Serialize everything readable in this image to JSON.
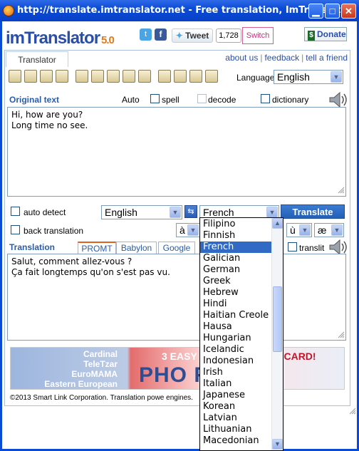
{
  "window": {
    "title": "http://translate.imtranslator.net - Free translation, ImTranslat...",
    "minimize_glyph": "▁",
    "maximize_glyph": "□",
    "close_glyph": "✕"
  },
  "header": {
    "logo_prefix": "imTranslator",
    "logo_version": "5.0",
    "tweet_label": "Tweet",
    "tweet_count": "1,728",
    "switch_label": "Switch",
    "donate_label": "Donate"
  },
  "nav": {
    "tab_translator": "Translator",
    "links": [
      "about us",
      "feedback",
      "tell a friend"
    ]
  },
  "toolbar": {
    "language_label": "Language",
    "language_value": "English",
    "icons": [
      "edit-icon",
      "print-icon",
      "virtual-keyboard-icon",
      "clear-icon",
      "dictionary-book-icon",
      "spell-check-icon",
      "keyboard-icon",
      "settings-icon",
      "voice-icon",
      "printer-icon",
      "image-icon",
      "history-icon",
      "help-icon"
    ]
  },
  "original": {
    "label": "Original text",
    "auto_label": "Auto",
    "spell_label": "spell",
    "decode_label": "decode",
    "dictionary_label": "dictionary",
    "text": "Hi, how are you?\nLong time no see."
  },
  "controls": {
    "auto_detect_label": "auto detect",
    "back_translation_label": "back translation",
    "source_lang": "English",
    "target_lang": "French",
    "translate_label": "Translate",
    "char_a": "à",
    "char_u": "ù",
    "char_ae": "æ",
    "swap_glyph": "⇆"
  },
  "translation": {
    "label": "Translation",
    "engines": [
      "PROMT",
      "Babylon",
      "Google"
    ],
    "translit_label": "translit",
    "text": "Salut, comment allez-vous ?\nÇa fait longtemps qu'on s'est pas vu."
  },
  "banner": {
    "links": [
      "Cardinal",
      "TeleTzar",
      "EuroMAMA",
      "Eastern European"
    ],
    "easy": "3 EASY",
    "card": "A CARD!",
    "big": "PHO        RDS"
  },
  "footer": {
    "text": "©2013 Smart Link Corporation. Translation powe                           engines."
  },
  "dropdown": {
    "items": [
      "Filipino",
      "Finnish",
      "French",
      "Galician",
      "German",
      "Greek",
      "Hebrew",
      "Hindi",
      "Haitian Creole",
      "Hausa",
      "Hungarian",
      "Icelandic",
      "Indonesian",
      "Irish",
      "Italian",
      "Japanese",
      "Korean",
      "Latvian",
      "Lithuanian",
      "Macedonian"
    ],
    "selected_index": 2
  },
  "colors": {
    "titlebar": "#0a4bd6",
    "accent": "#2b5ca8",
    "selection": "#316ac5"
  }
}
